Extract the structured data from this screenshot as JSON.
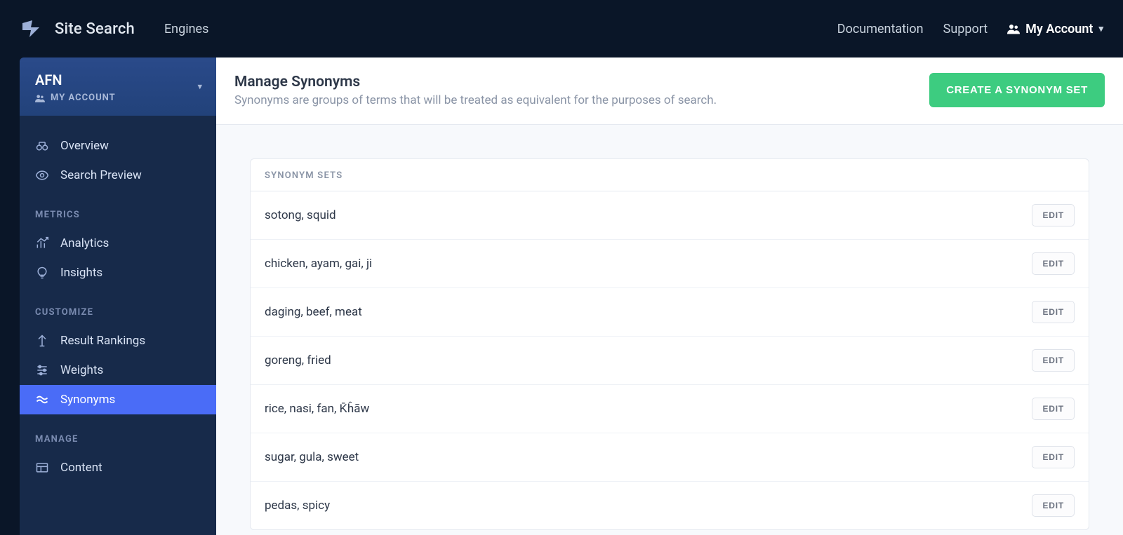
{
  "topbar": {
    "brand": "Site Search",
    "engines_link": "Engines",
    "documentation": "Documentation",
    "support": "Support",
    "account_label": "My Account"
  },
  "sidebar": {
    "engine_name": "AFN",
    "engine_sub": "MY ACCOUNT",
    "groups": {
      "top": [
        {
          "label": "Overview",
          "icon": "binoculars"
        },
        {
          "label": "Search Preview",
          "icon": "eye"
        }
      ],
      "metrics_heading": "METRICS",
      "metrics": [
        {
          "label": "Analytics",
          "icon": "chart"
        },
        {
          "label": "Insights",
          "icon": "bulb"
        }
      ],
      "customize_heading": "CUSTOMIZE",
      "customize": [
        {
          "label": "Result Rankings",
          "icon": "rankings"
        },
        {
          "label": "Weights",
          "icon": "sliders"
        },
        {
          "label": "Synonyms",
          "icon": "synonyms",
          "active": true
        }
      ],
      "manage_heading": "MANAGE",
      "manage": [
        {
          "label": "Content",
          "icon": "content"
        }
      ]
    }
  },
  "page": {
    "title": "Manage Synonyms",
    "subtitle": "Synonyms are groups of terms that will be treated as equivalent for the purposes of search.",
    "create_button": "CREATE A SYNONYM SET",
    "panel_heading": "SYNONYM SETS",
    "edit_label": "EDIT",
    "sets": [
      "sotong, squid",
      "chicken, ayam, gai, ji",
      "daging, beef, meat",
      "goreng, fried",
      "rice, nasi, fan, K̄ĥāw",
      "sugar, gula, sweet",
      "pedas, spicy"
    ]
  }
}
